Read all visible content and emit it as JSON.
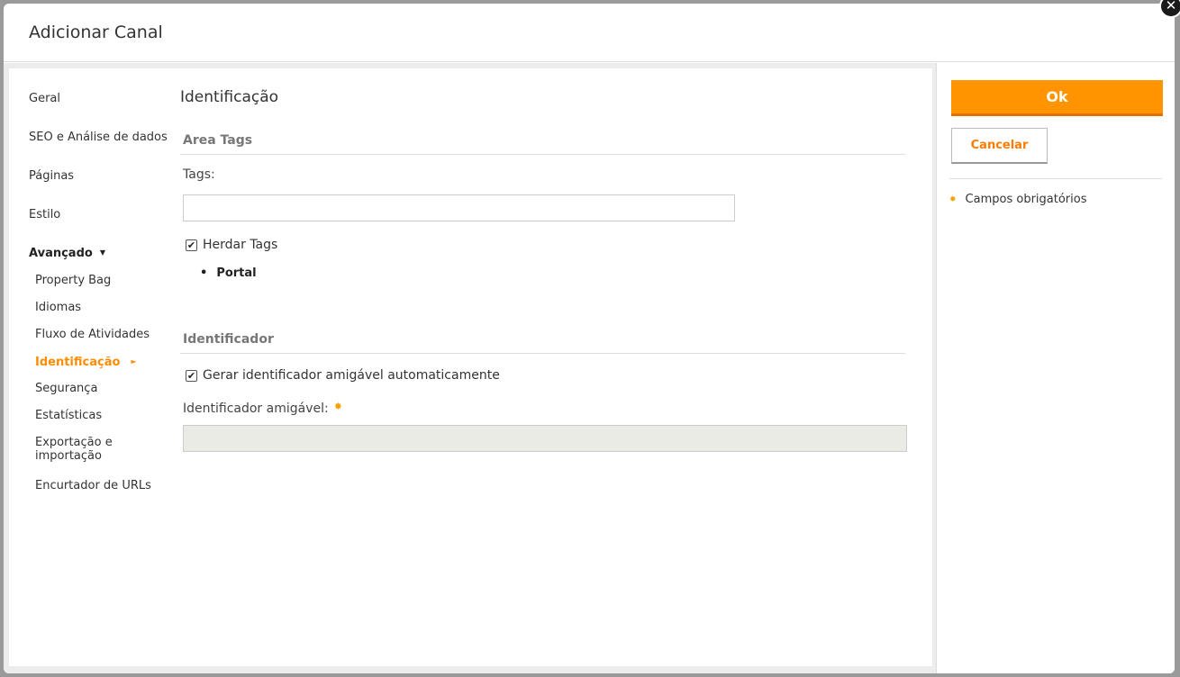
{
  "dialog": {
    "title": "Adicionar Canal",
    "close_glyph": "✕"
  },
  "nav": {
    "items": [
      {
        "label": "Geral"
      },
      {
        "label": "SEO e Análise de dados"
      },
      {
        "label": "Páginas"
      },
      {
        "label": "Estilo"
      }
    ],
    "advanced": {
      "label": "Avançado",
      "caret": "▼",
      "sub_items": [
        {
          "label": "Property Bag"
        },
        {
          "label": "Idiomas"
        },
        {
          "label": "Fluxo de Atividades"
        },
        {
          "label": "Identificação",
          "active": true
        },
        {
          "label": "Segurança"
        },
        {
          "label": "Estatísticas"
        },
        {
          "label": "Exportação e importação"
        },
        {
          "label": "Encurtador de URLs"
        }
      ],
      "active_arrow": "►"
    }
  },
  "content": {
    "section_title": "Identificação",
    "area_tags": {
      "header": "Area Tags",
      "tags_label": "Tags:",
      "tags_value": "",
      "inherit_label": "Herdar Tags",
      "inherit_checked": true,
      "inherited_items": [
        "Portal"
      ]
    },
    "identifier": {
      "header": "Identificador",
      "auto_label": "Gerar identificador amigável automaticamente",
      "auto_checked": true,
      "friendly_label": "Identificador amigável:",
      "friendly_value": ""
    }
  },
  "side": {
    "ok_label": "Ok",
    "cancel_label": "Cancelar",
    "required_note": "Campos obrigatórios"
  },
  "colors": {
    "accent": "#ff9400",
    "accent_text": "#ff7b00",
    "required": "#f0a000"
  }
}
